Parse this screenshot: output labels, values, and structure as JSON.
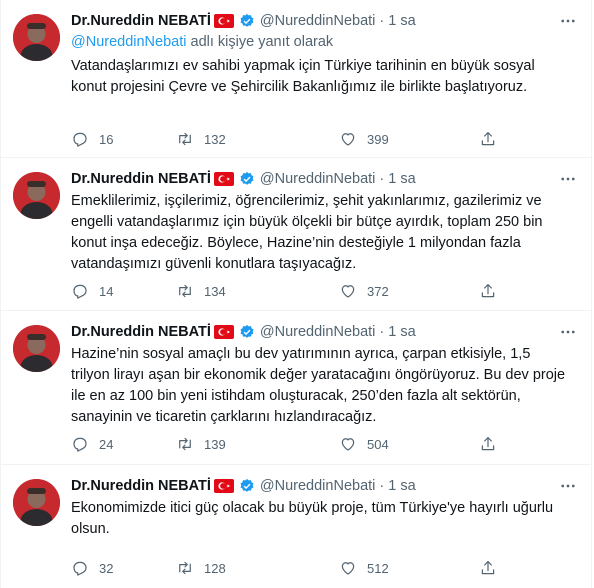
{
  "tweets": [
    {
      "author": "Dr.Nureddin NEBATİ",
      "handle": "@NureddinNebati",
      "time": "1 sa",
      "reply_to_handle": "@NureddinNebati",
      "reply_to_suffix": " adlı kişiye yanıt olarak",
      "text": "Vatandaşlarımızı ev sahibi yapmak için Türkiye tarihinin en büyük sosyal konut projesini Çevre ve Şehircilik Bakanlığımız ile birlikte başlatıyoruz.",
      "replies": "16",
      "retweets": "132",
      "likes": "399"
    },
    {
      "author": "Dr.Nureddin NEBATİ",
      "handle": "@NureddinNebati",
      "time": "1 sa",
      "text": "Emeklilerimiz, işçilerimiz, öğrencilerimiz, şehit yakınlarımız, gazilerimiz ve engelli vatandaşlarımız için büyük ölçekli bir bütçe ayırdık, toplam 250 bin konut inşa edeceğiz. Böylece, Hazine’nin desteğiyle 1 milyondan fazla vatandaşımızı güvenli konutlara taşıyacağız.",
      "replies": "14",
      "retweets": "134",
      "likes": "372"
    },
    {
      "author": "Dr.Nureddin NEBATİ",
      "handle": "@NureddinNebati",
      "time": "1 sa",
      "text": "Hazine’nin sosyal amaçlı bu dev yatırımının ayrıca, çarpan etkisiyle, 1,5 trilyon lirayı aşan bir ekonomik değer yaratacağını öngörüyoruz. Bu dev proje ile en az 100 bin yeni istihdam oluşturacak, 250’den fazla alt sektörün, sanayinin ve ticaretin çarklarını hızlandıracağız.",
      "replies": "24",
      "retweets": "139",
      "likes": "504"
    },
    {
      "author": "Dr.Nureddin NEBATİ",
      "handle": "@NureddinNebati",
      "time": "1 sa",
      "text": "Ekonomimizde itici güç olacak bu büyük proje, tüm Türkiye'ye hayırlı uğurlu olsun.",
      "replies": "32",
      "retweets": "128",
      "likes": "512"
    }
  ],
  "colors": {
    "link": "#1d9bf0",
    "muted": "#536471",
    "text": "#0f1419",
    "flag": "#e30a17",
    "verified": "#1d9bf0"
  },
  "icons": [
    "turkey-flag-icon",
    "verified-badge-icon",
    "more-icon",
    "reply-icon",
    "retweet-icon",
    "like-icon",
    "share-icon"
  ]
}
